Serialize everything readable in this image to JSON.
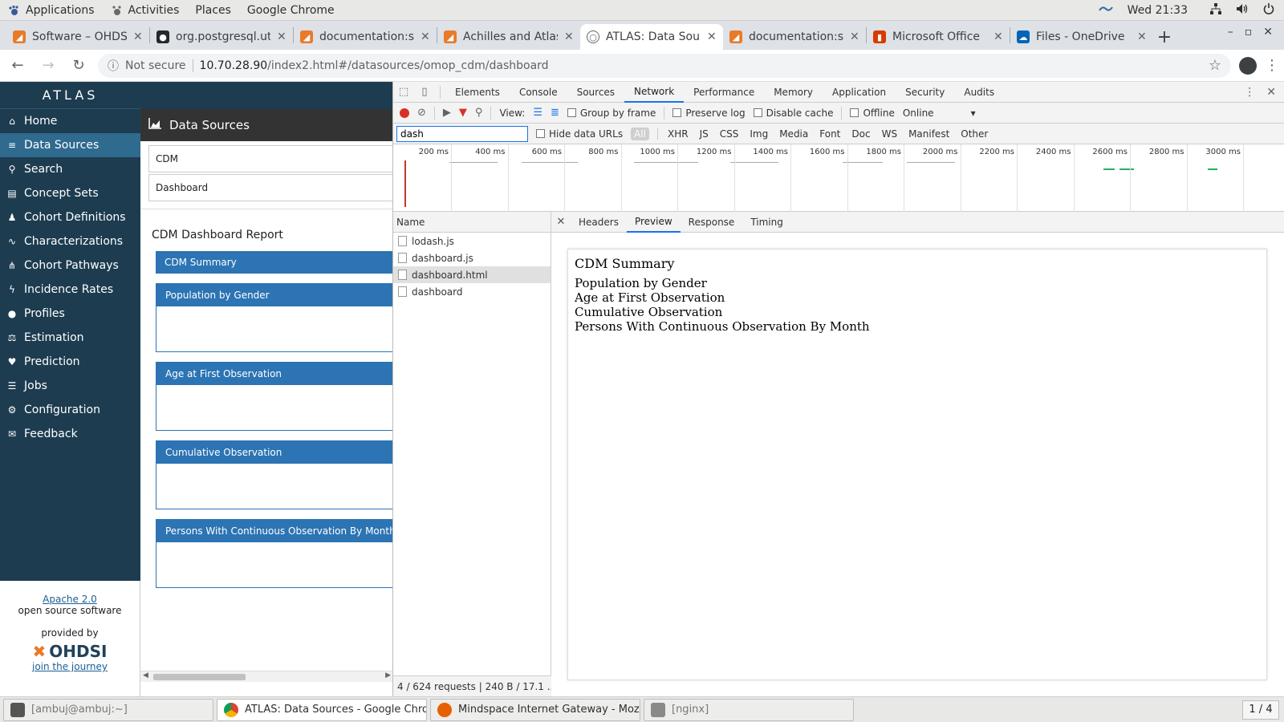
{
  "gnome": {
    "applications": "Applications",
    "activities": "Activities",
    "places": "Places",
    "app_name": "Google Chrome",
    "clock": "Wed 21:33"
  },
  "tabs": [
    {
      "title": "Software – OHDSI",
      "color": "#e97a28",
      "fav": "◢"
    },
    {
      "title": "org.postgresql.util",
      "color": "#24292e",
      "fav": "●"
    },
    {
      "title": "documentation:sof",
      "color": "#e97a28",
      "fav": "◢"
    },
    {
      "title": "Achilles and Atlas",
      "color": "#e97a28",
      "fav": "◢"
    },
    {
      "title": "ATLAS: Data Sour",
      "color": "#5f6368",
      "fav": "○"
    },
    {
      "title": "documentation:sof",
      "color": "#e97a28",
      "fav": "◢"
    },
    {
      "title": "Microsoft Office",
      "color": "#d83b01",
      "fav": "▮"
    },
    {
      "title": "Files - OneDrive",
      "color": "#0364b8",
      "fav": "☁"
    }
  ],
  "address": {
    "not_secure": "Not secure",
    "host": "10.70.28.90",
    "path": "/index2.html#/datasources/omop_cdm/dashboard"
  },
  "atlas": {
    "logo": "ATLAS",
    "nav": [
      {
        "label": "Home",
        "icon": "⌂"
      },
      {
        "label": "Data Sources",
        "icon": "≡"
      },
      {
        "label": "Search",
        "icon": "⚲"
      },
      {
        "label": "Concept Sets",
        "icon": "▤"
      },
      {
        "label": "Cohort Definitions",
        "icon": "♟"
      },
      {
        "label": "Characterizations",
        "icon": "∿"
      },
      {
        "label": "Cohort Pathways",
        "icon": "⋔"
      },
      {
        "label": "Incidence Rates",
        "icon": "ϟ"
      },
      {
        "label": "Profiles",
        "icon": "●"
      },
      {
        "label": "Estimation",
        "icon": "⚖"
      },
      {
        "label": "Prediction",
        "icon": "♥"
      },
      {
        "label": "Jobs",
        "icon": "☰"
      },
      {
        "label": "Configuration",
        "icon": "⚙"
      },
      {
        "label": "Feedback",
        "icon": "✉"
      }
    ],
    "footer": {
      "license": "Apache 2.0",
      "oss": "open source software",
      "provided_by": "provided by",
      "brand": "OHDSI",
      "journey": "join the journey"
    },
    "header": "Data Sources",
    "source_select": "CDM",
    "report_select": "Dashboard",
    "report_title": "CDM Dashboard Report",
    "summary": "CDM Summary",
    "panels": [
      "Population by Gender",
      "Age at First Observation",
      "Cumulative Observation",
      "Persons With Continuous Observation By Month"
    ]
  },
  "devtools": {
    "tabs": [
      "Elements",
      "Console",
      "Sources",
      "Network",
      "Performance",
      "Memory",
      "Application",
      "Security",
      "Audits"
    ],
    "active_tab": "Network",
    "view_label": "View:",
    "group_by_frame": "Group by frame",
    "preserve_log": "Preserve log",
    "disable_cache": "Disable cache",
    "offline": "Offline",
    "throttle": "Online",
    "filter_value": "dash",
    "hide_data_urls": "Hide data URLs",
    "types": [
      "All",
      "XHR",
      "JS",
      "CSS",
      "Img",
      "Media",
      "Font",
      "Doc",
      "WS",
      "Manifest",
      "Other"
    ],
    "ticks": [
      "200 ms",
      "400 ms",
      "600 ms",
      "800 ms",
      "1000 ms",
      "1200 ms",
      "1400 ms",
      "1600 ms",
      "1800 ms",
      "2000 ms",
      "2200 ms",
      "2400 ms",
      "2600 ms",
      "2800 ms",
      "3000 ms"
    ],
    "name_header": "Name",
    "requests": [
      "lodash.js",
      "dashboard.js",
      "dashboard.html",
      "dashboard"
    ],
    "selected_request": "dashboard.html",
    "status": "4 / 624 requests  |  240 B / 17.1 ...",
    "detail_tabs": [
      "Headers",
      "Preview",
      "Response",
      "Timing"
    ],
    "active_detail": "Preview",
    "preview": {
      "heading": "CDM Summary",
      "lines": [
        "Population by Gender",
        "Age at First Observation",
        "Cumulative Observation",
        "Persons With Continuous Observation By Month"
      ]
    }
  },
  "taskbar": [
    {
      "label": "[ambuj@ambuj:~]",
      "color": "#555"
    },
    {
      "label": "ATLAS: Data Sources - Google Chro...",
      "color": "#4285f4"
    },
    {
      "label": "Mindspace Internet Gateway - Mozill...",
      "color": "#e66000"
    },
    {
      "label": "[nginx]",
      "color": "#8a8a8a"
    }
  ],
  "workspace": "1 / 4"
}
